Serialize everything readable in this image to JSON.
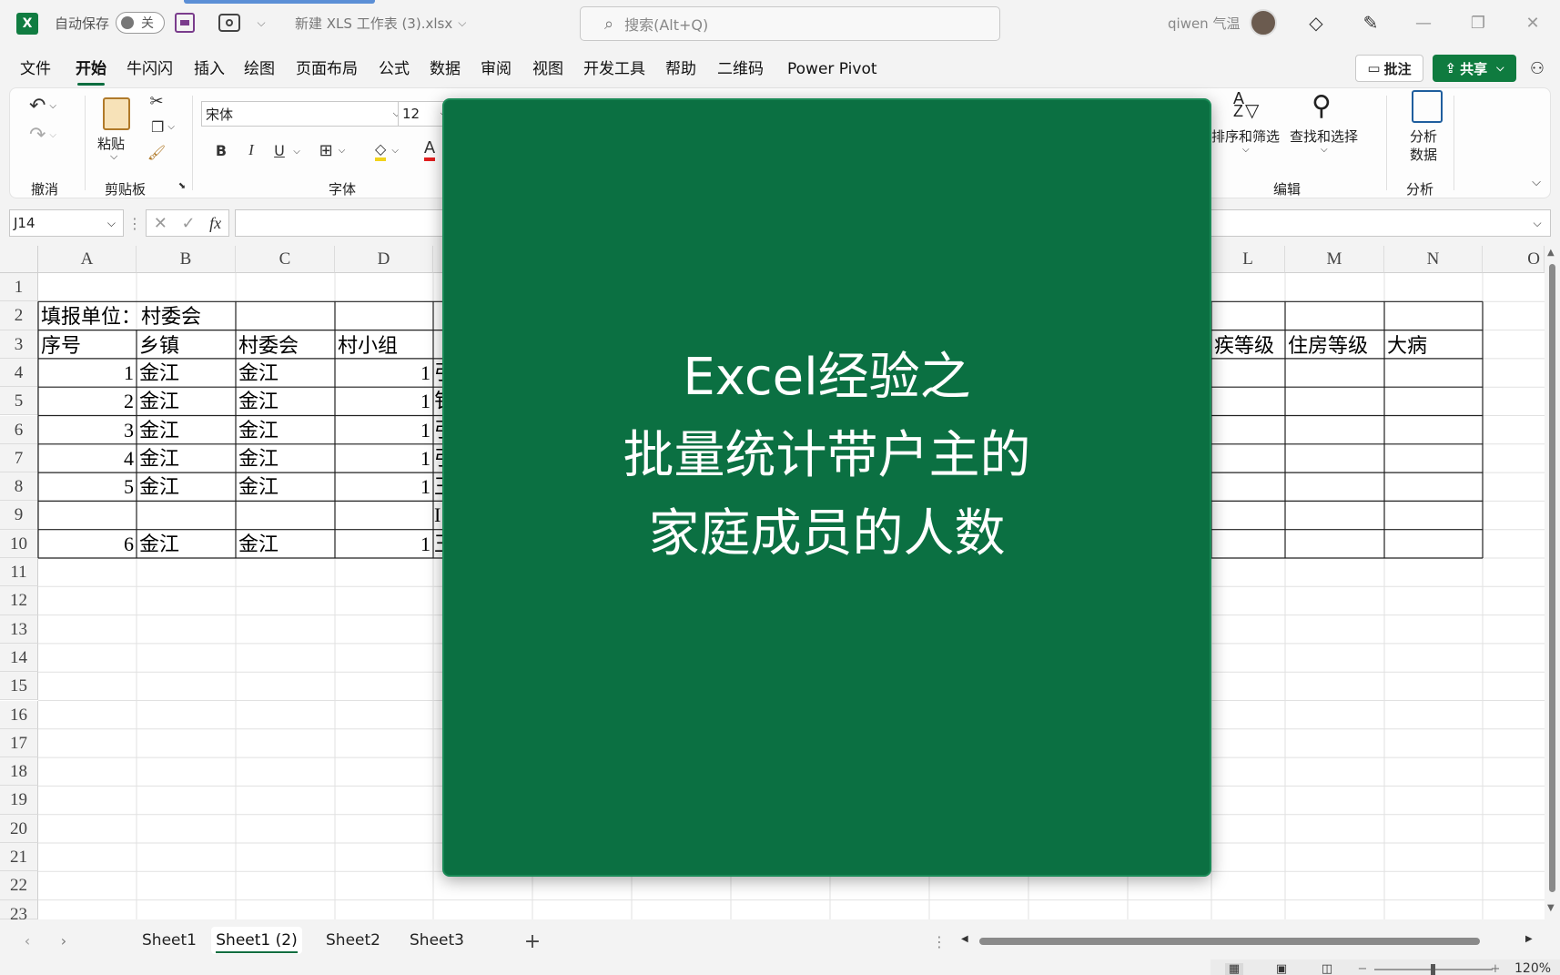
{
  "titlebar": {
    "autosave_label": "自动保存",
    "autosave_state": "关",
    "filename": "新建 XLS 工作表 (3).xlsx",
    "search_placeholder": "搜索(Alt+Q)",
    "user_name": "qiwen 气温"
  },
  "menu": {
    "items": [
      "文件",
      "开始",
      "牛闪闪",
      "插入",
      "绘图",
      "页面布局",
      "公式",
      "数据",
      "审阅",
      "视图",
      "开发工具",
      "帮助",
      "二维码",
      "Power Pivot"
    ],
    "active": "开始",
    "comment_button": "批注",
    "share_button": "共享"
  },
  "ribbon": {
    "group_undo": "撤消",
    "paste_label": "粘贴",
    "group_clipboard": "剪贴板",
    "font_name": "宋体",
    "font_size": "12",
    "bold": "B",
    "italic": "I",
    "underline": "U",
    "font_color_glyph": "A",
    "group_font": "字体",
    "sort_filter": "排序和筛选",
    "find_select": "查找和选择",
    "group_edit": "编辑",
    "analyze_line1": "分析",
    "analyze_line2": "数据",
    "group_analyze": "分析"
  },
  "formula_bar": {
    "name_box": "J14",
    "fx": "fx"
  },
  "sheet": {
    "left_columns": [
      "A",
      "B",
      "C",
      "D"
    ],
    "right_columns": [
      "L",
      "M",
      "N",
      "O"
    ],
    "rows": [
      "1",
      "2",
      "3",
      "4",
      "5",
      "6",
      "7",
      "8",
      "9",
      "10",
      "11",
      "12",
      "13",
      "14",
      "15",
      "16",
      "17",
      "18",
      "19",
      "20",
      "21",
      "22",
      "23"
    ],
    "row2_a": "填报单位：村委会",
    "header_row": {
      "a": "序号",
      "b": "乡镇",
      "c": "村委会",
      "d": "村小组",
      "l": "疾等级",
      "m": "住房等级",
      "n": "大病"
    },
    "data_rows": [
      {
        "a": "1",
        "b": "金江",
        "c": "金江",
        "d": "1",
        "e": "引"
      },
      {
        "a": "2",
        "b": "金江",
        "c": "金江",
        "d": "1",
        "e": "钅"
      },
      {
        "a": "3",
        "b": "金江",
        "c": "金江",
        "d": "1",
        "e": "引"
      },
      {
        "a": "4",
        "b": "金江",
        "c": "金江",
        "d": "1",
        "e": "引"
      },
      {
        "a": "5",
        "b": "金江",
        "c": "金江",
        "d": "1",
        "e": "王"
      },
      {
        "a": "",
        "b": "",
        "c": "",
        "d": "",
        "e": "I"
      },
      {
        "a": "6",
        "b": "金江",
        "c": "金江",
        "d": "1",
        "e": "王"
      }
    ]
  },
  "overlay": {
    "line1": "Excel经验之",
    "line2": "批量统计带户主的",
    "line3": "家庭成员的人数"
  },
  "tabs": [
    "Sheet1",
    "Sheet1 (2)",
    "Sheet2",
    "Sheet3"
  ],
  "active_tab": "Sheet1 (2)",
  "status": {
    "zoom": "120%"
  },
  "colors": {
    "accent": "#0b6d3f",
    "overlay_bg": "#0b7042"
  }
}
